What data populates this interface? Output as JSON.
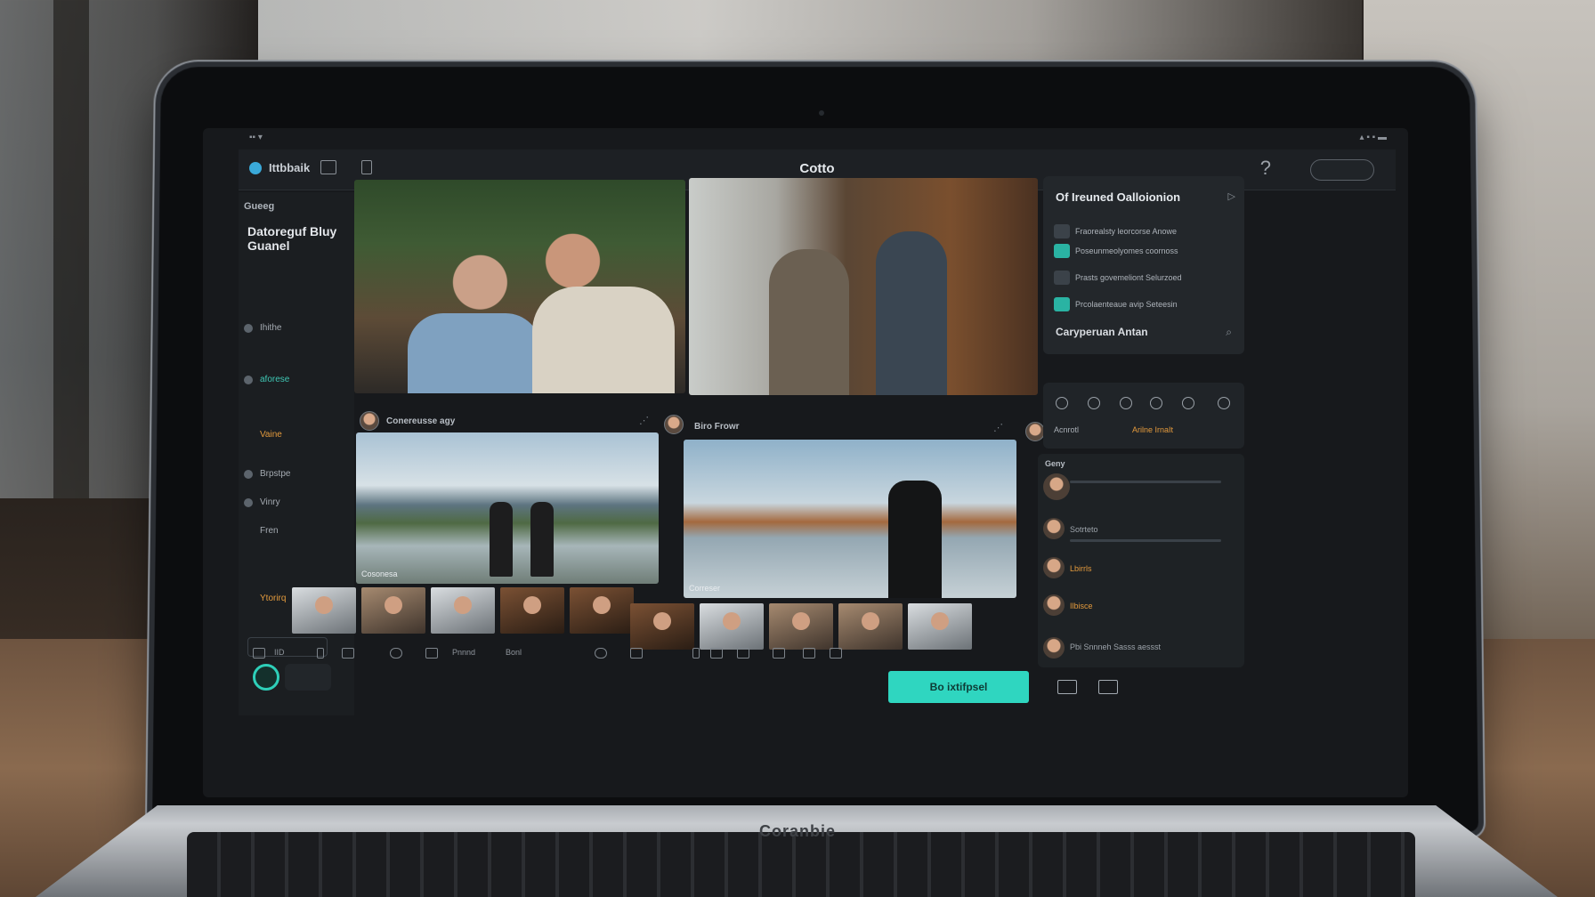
{
  "window": {
    "app_name": "Ittbbaik",
    "doc_title": "Cotto"
  },
  "sidebar": {
    "heading": "Gueeg",
    "title": "Datoreguf Bluy Guanel",
    "items": [
      {
        "label": "Ihithe",
        "style": "normal"
      },
      {
        "label": "aforese",
        "style": "accent"
      },
      {
        "label": "Vaine",
        "style": "orange"
      },
      {
        "label": "Brpstpe",
        "style": "normal"
      },
      {
        "label": "Vinry",
        "style": "normal"
      },
      {
        "label": "Fren",
        "style": "normal"
      },
      {
        "label": "Ytorirq",
        "style": "orange"
      }
    ]
  },
  "main": {
    "row2_left_label": "Conereusse agy",
    "row2_right_label": "Biro Frowr",
    "photo3_caption": "Cosonesa",
    "photo4_caption": "Correser"
  },
  "bottombar": {
    "labels": [
      "IID",
      "Pnnnd",
      "Bonl"
    ],
    "primary_button": "Bo ixtifpsel"
  },
  "right_panel": {
    "title": "Of Ireuned Oalloionion",
    "rows": [
      "Fraorealsty leorcorse Anowe",
      "Poseunmeolyomes coornoss",
      "Prasts govemeliont Selurzoed",
      "Prcolaenteaue avip Seteesin"
    ],
    "footer": "Caryperuan Antan",
    "tools_label": "Acnrotl",
    "tools_value": "Arilne IrnaIt",
    "chat_heading": "Geny",
    "chat": [
      {
        "text": "Sotrteto",
        "style": "normal"
      },
      {
        "text": "Lbirrls",
        "style": "orange"
      },
      {
        "text": "Ilbisce",
        "style": "orange"
      },
      {
        "text": "Pbi Snnneh Sasss aessst",
        "style": "normal"
      }
    ]
  },
  "laptop_brand": "Coranbie",
  "colors": {
    "accent": "#2fd6c0",
    "warning": "#e39a3d",
    "surface": "#17191c"
  }
}
